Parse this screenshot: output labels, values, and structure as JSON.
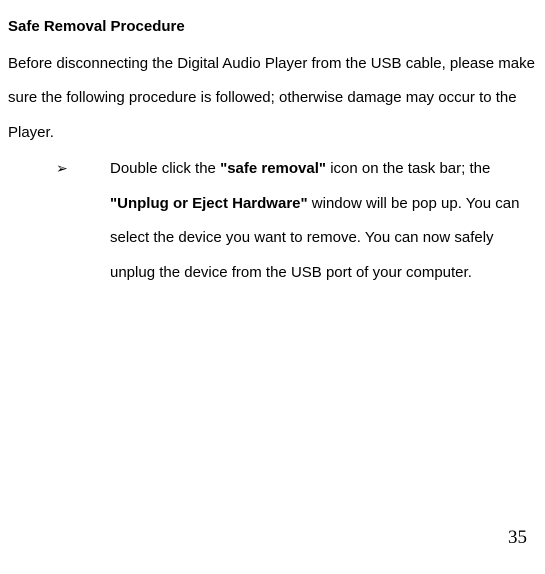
{
  "heading": "Safe Removal Procedure",
  "intro": "Before disconnecting the Digital Audio Player from the USB cable, please make sure the following procedure is followed; otherwise damage may occur to the Player.",
  "bullet": {
    "marker": "➢",
    "seg1": "Double click the ",
    "bold1_open": "\"",
    "bold1_text": "safe removal",
    "bold1_close": "\"",
    "seg2": " icon on the task bar; the ",
    "bold2_open": "\"",
    "bold2_text": "Unplug or Eject Hardware",
    "bold2_close": "\"",
    "seg3": " window will be pop up. You can select the device you want to remove. You can now safely unplug the device from the USB port of your computer."
  },
  "page_number": "35"
}
